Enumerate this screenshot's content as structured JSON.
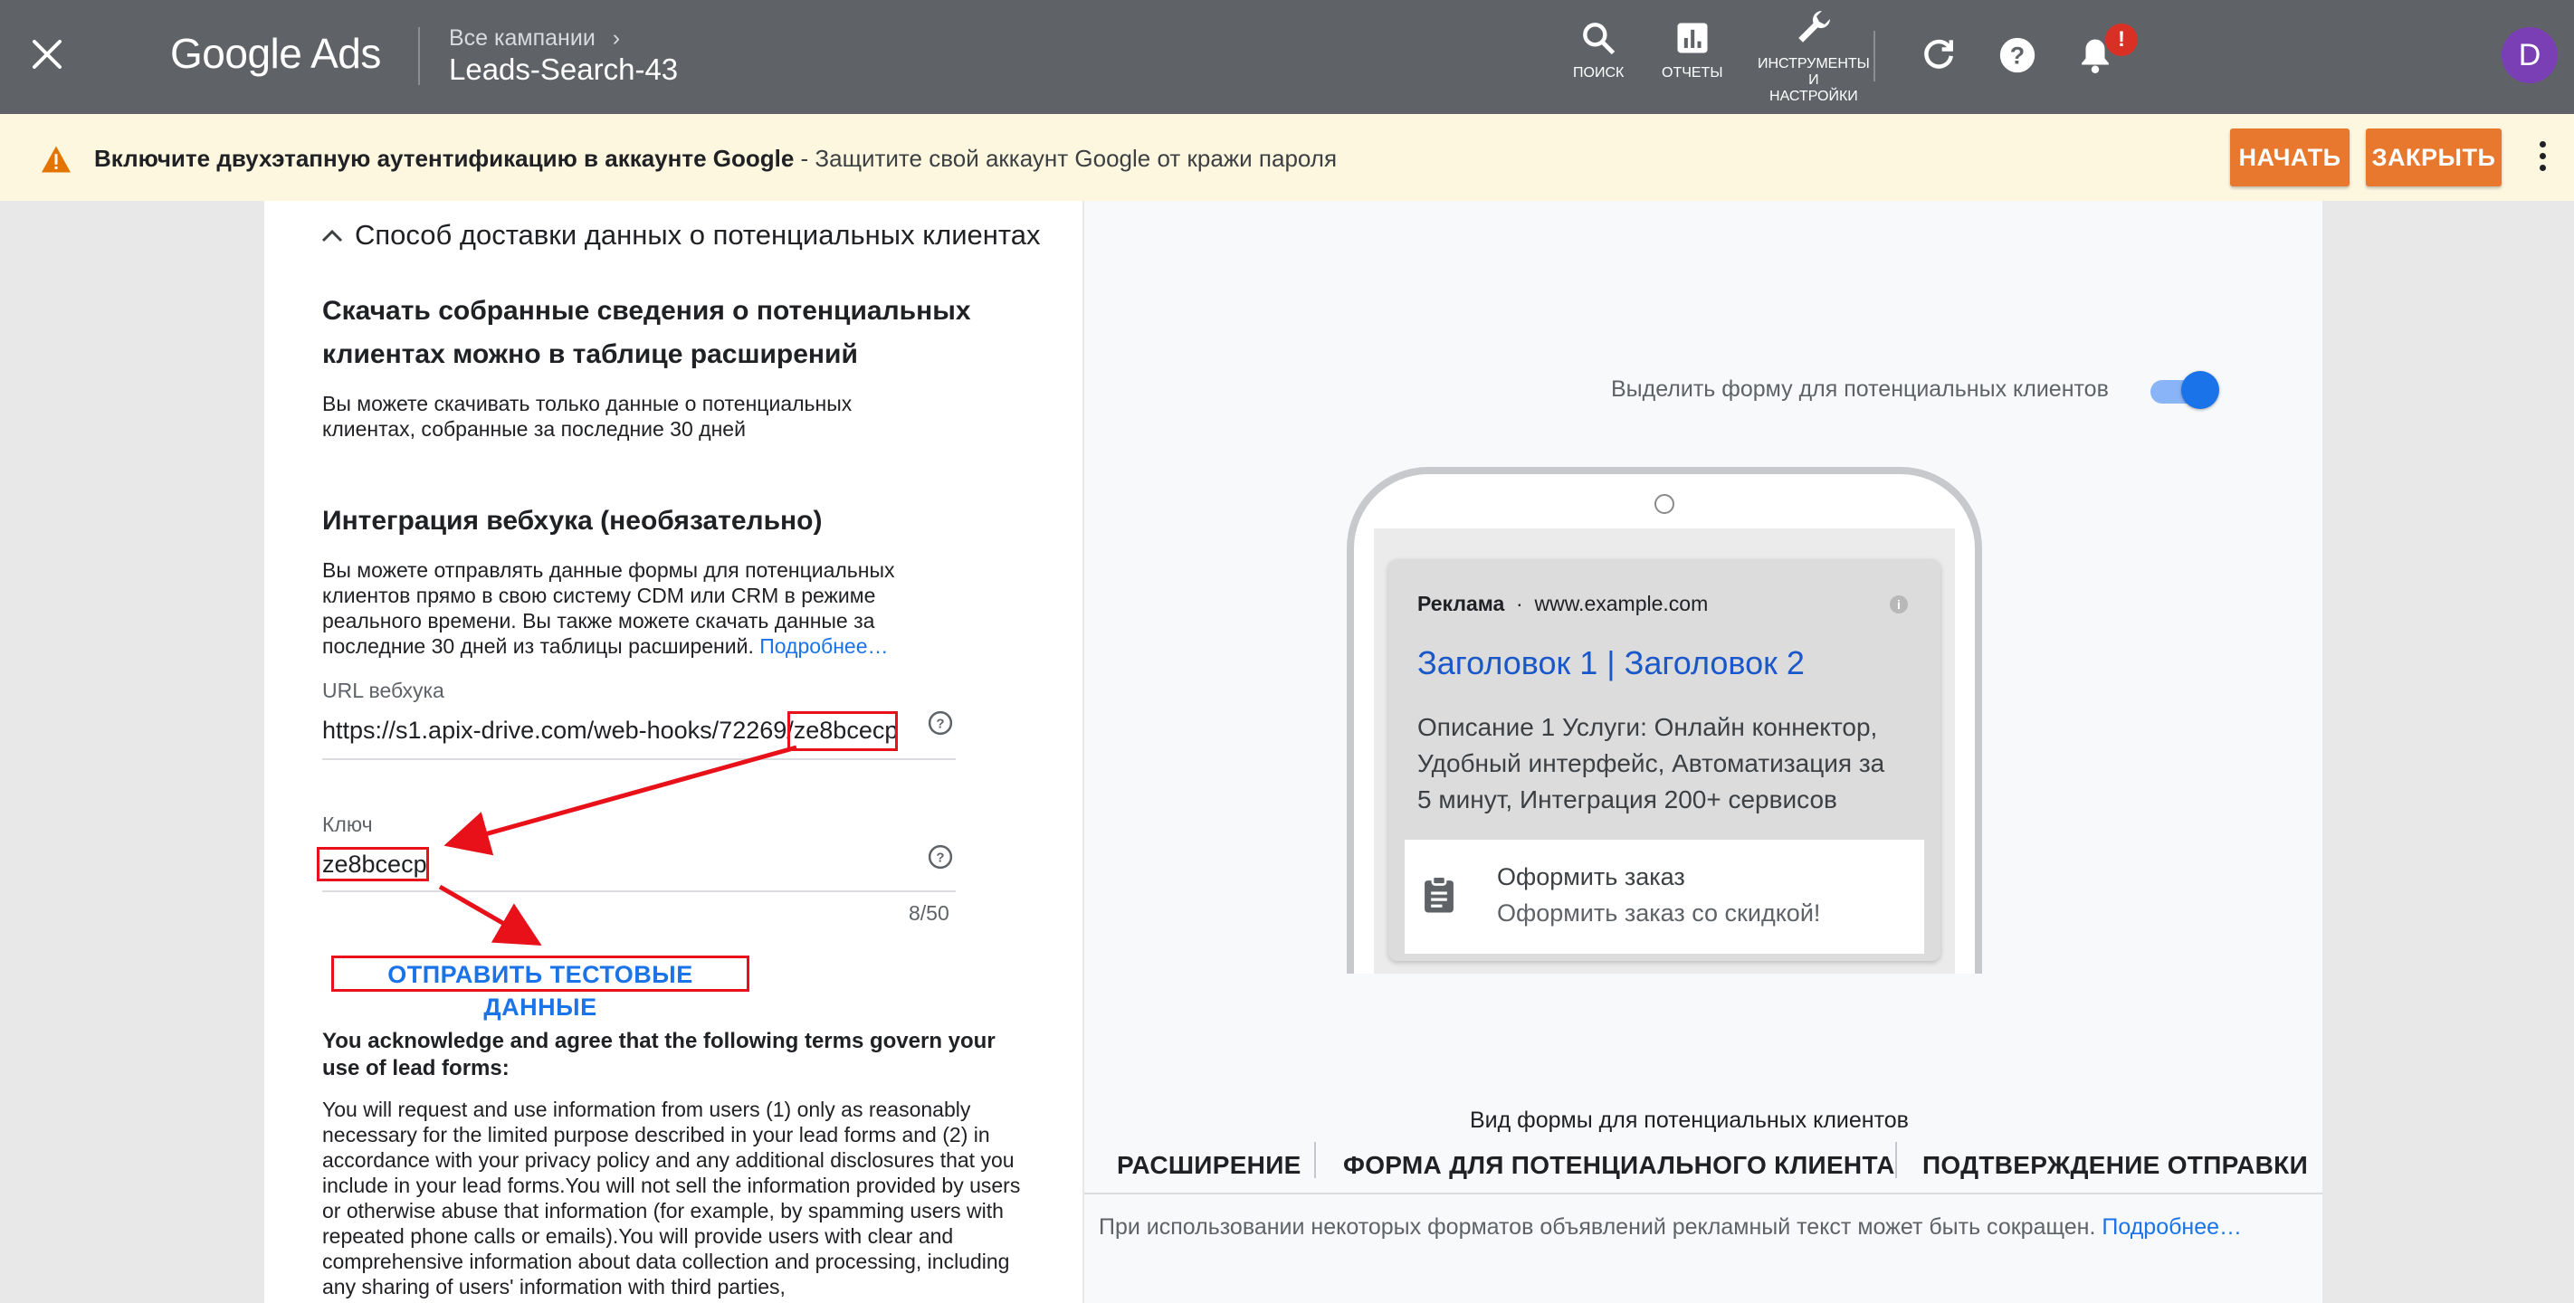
{
  "topbar": {
    "logo": "Google Ads",
    "breadcrumb_parent": "Все кампании",
    "campaign": "Leads-Search-43",
    "tools": {
      "search": "ПОИСК",
      "reports": "ОТЧЕТЫ",
      "tools_l1": "ИНСТРУМЕНТЫ",
      "tools_l2": "И",
      "tools_l3": "НАСТРОЙКИ"
    },
    "notification_badge": "!",
    "avatar_letter": "D"
  },
  "banner": {
    "title": "Включите двухэтапную аутентификацию в аккаунте Google",
    "text": " - Защитите свой аккаунт Google от кражи пароля",
    "start_button": "НАЧАТЬ",
    "close_button": "ЗАКРЫТЬ"
  },
  "left": {
    "section_title": "Способ доставки данных о потенциальных клиентах",
    "download_heading_l1": "Скачать собранные сведения о потенциальных",
    "download_heading_l2": "клиентах можно в таблице расширений",
    "download_text_l1": "Вы можете скачивать только данные о потенциальных",
    "download_text_l2": "клиентах, собранные за последние 30 дней",
    "webhook_heading": "Интеграция вебхука (необязательно)",
    "webhook_text_l1": "Вы можете отправлять данные формы для потенциальных",
    "webhook_text_l2": "клиентов прямо в свою систему CDM или CRM в режиме",
    "webhook_text_l3": "реального времени. Вы также можете скачать данные за",
    "webhook_text_l4": "последние 30 дней из таблицы расширений.",
    "webhook_more_link": "Подробнее…",
    "url_label": "URL вебхука",
    "url_value_prefix": "https://s1.apix-drive.com/web-hooks/72269/",
    "url_value_key": "ze8bcecp",
    "key_label": "Ключ",
    "key_value": "ze8bcecp",
    "key_counter": "8/50",
    "send_test_button": "ОТПРАВИТЬ ТЕСТОВЫЕ ДАННЫЕ",
    "terms_heading": "You acknowledge and agree that the following terms govern your use of lead forms:",
    "terms_text": "You will request and use information from users (1) only as reasonably necessary for the limited purpose described in your lead forms and (2) in accordance with your privacy policy and any additional disclosures that you include in your lead forms.You will not sell the information provided by users or otherwise abuse that information (for example, by spamming users with repeated phone calls or emails).You will provide users with clear and comprehensive information about data collection and processing, including any sharing of users' information with third parties,"
  },
  "right": {
    "highlight_toggle_label": "Выделить форму для потенциальных клиентов",
    "highlight_toggle_on": true,
    "preview": {
      "ad_label": "Реклама",
      "ad_url": "www.example.com",
      "ad_title": "Заголовок 1 | Заголовок 2",
      "ad_desc_l1": "Описание 1 Услуги: Онлайн коннектор,",
      "ad_desc_l2": "Удобный интерфейс, Автоматизация за",
      "ad_desc_l3": "5 минут, Интеграция 200+ сервисов",
      "form_title": "Оформить заказ",
      "form_subtitle": "Оформить заказ со скидкой!"
    },
    "view_caption": "Вид формы для потенциальных клиентов",
    "tabs": [
      "РАСШИРЕНИЕ",
      "ФОРМА ДЛЯ ПОТЕНЦИАЛЬНОГО КЛИЕНТА",
      "ПОДТВЕРЖДЕНИЕ ОТПРАВКИ"
    ],
    "note_text": "При использовании некоторых форматов объявлений рекламный текст может быть сокращен.",
    "note_link": "Подробнее…"
  },
  "colors": {
    "topbar": "#5f6368",
    "banner": "#fef7e0",
    "orange_button": "#e8782e",
    "link": "#1a73e8",
    "annotation_red": "#e8111a"
  }
}
